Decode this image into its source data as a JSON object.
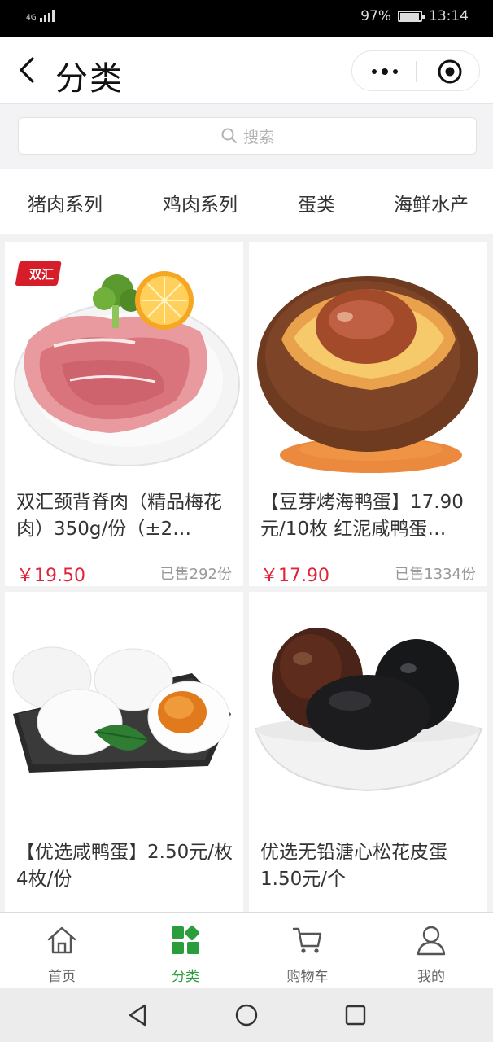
{
  "status_bar": {
    "network": "4G",
    "battery": "97%",
    "time": "13:14",
    "icons": [
      "signal-icon",
      "battery-icon"
    ]
  },
  "title_bar": {
    "title": "分类",
    "icons": [
      "back-arrow-icon",
      "more-dots-icon",
      "target-circle-icon"
    ]
  },
  "search": {
    "placeholder": "搜索",
    "icon": "search-icon"
  },
  "category_tabs": [
    {
      "label": "猪肉系列"
    },
    {
      "label": "鸡肉系列"
    },
    {
      "label": "蛋类"
    },
    {
      "label": "海鲜水产"
    }
  ],
  "products": [
    {
      "name": "双汇颈背脊肉（精品梅花肉）350g/份（±2…",
      "price": "￥19.50",
      "sold": "已售292份",
      "brand": "双汇",
      "image": "pork-chops-plate"
    },
    {
      "name": "【豆芽烤海鸭蛋】17.90元/10枚 红泥咸鸭蛋…",
      "price": "￥17.90",
      "sold": "已售1334份",
      "image": "roasted-sea-duck-egg"
    },
    {
      "name": "【优选咸鸭蛋】2.50元/枚 4枚/份",
      "price": "",
      "sold": "",
      "image": "salted-duck-eggs"
    },
    {
      "name": "优选无铅溏心松花皮蛋1.50元/个",
      "price": "",
      "sold": "",
      "image": "century-eggs-bowl"
    }
  ],
  "bottom_nav": [
    {
      "label": "首页",
      "icon": "home-icon",
      "active": false
    },
    {
      "label": "分类",
      "icon": "category-grid-icon",
      "active": true
    },
    {
      "label": "购物车",
      "icon": "cart-icon",
      "active": false
    },
    {
      "label": "我的",
      "icon": "user-icon",
      "active": false
    }
  ],
  "android_nav": {
    "icons": [
      "back-triangle-icon",
      "home-circle-icon",
      "recents-square-icon"
    ]
  },
  "colors": {
    "accent_green": "#2a9d3c",
    "price_red": "#e0253a"
  }
}
